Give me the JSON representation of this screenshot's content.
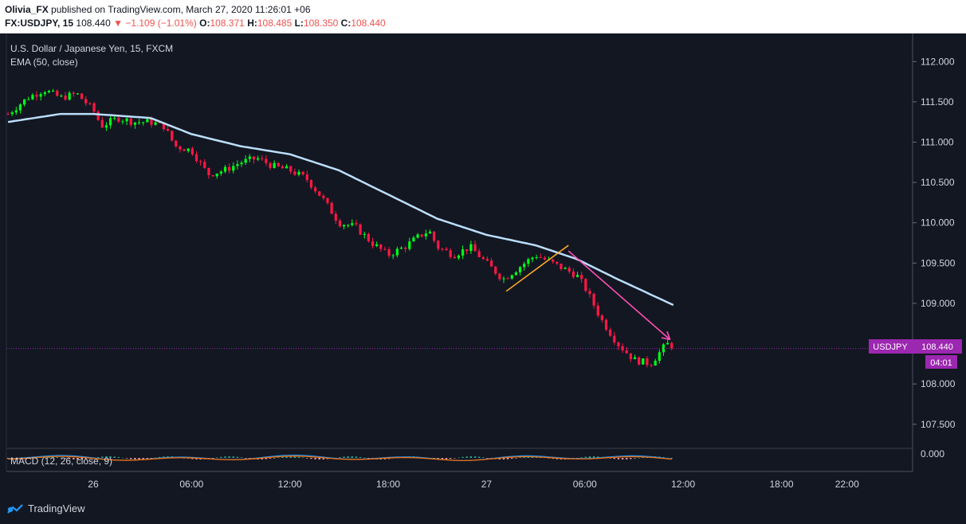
{
  "header": {
    "author": "Olivia_FX",
    "published": "published on TradingView.com, March 27, 2020 11:26:01 +06",
    "symbol": "FX:USDJPY, 15",
    "last": "108.440",
    "change": "−1.109 (−1.01%)",
    "o_label": "O:",
    "o_value": "108.371",
    "h_label": "H:",
    "h_value": "108.485",
    "l_label": "L:",
    "l_value": "108.350",
    "c_label": "C:",
    "c_value": "108.440"
  },
  "pane": {
    "title": "U.S. Dollar / Japanese Yen, 15, FXCM",
    "indicator": "EMA (50, close)",
    "macd": "MACD (12, 26, close, 9)",
    "price_label_symbol": "USDJPY",
    "price_label_value": "108.440",
    "countdown": "04:01",
    "macd_zero": "0.000"
  },
  "brand": {
    "name": "TradingView"
  },
  "colors": {
    "background": "#131722",
    "up": "#00ff1a",
    "down": "#ff1744",
    "ema": "#bbdefb",
    "badge": "#9c27b0",
    "trend_yellow": "#f9a825",
    "trend_pink": "#ff4fb4"
  },
  "chart_data": {
    "type": "candlestick",
    "title": "U.S. Dollar / Japanese Yen, 15, FXCM",
    "y_ticks": [
      "112.000",
      "111.500",
      "111.000",
      "110.500",
      "110.000",
      "109.500",
      "109.000",
      "108.500",
      "108.000",
      "107.500"
    ],
    "ylim": [
      107.3,
      112.25
    ],
    "x_ticks": [
      "26",
      "06:00",
      "12:00",
      "18:00",
      "27",
      "06:00",
      "12:00",
      "18:00",
      "22:00"
    ],
    "x_tick_hours": [
      0,
      6,
      12,
      18,
      24,
      30,
      36,
      42,
      46
    ],
    "xlim_hours": [
      -5.3,
      50
    ],
    "close_anchors": [
      [
        -5.2,
        111.35
      ],
      [
        -4.0,
        111.55
      ],
      [
        -3.0,
        111.65
      ],
      [
        -2.0,
        111.55
      ],
      [
        -1.0,
        111.6
      ],
      [
        0.0,
        111.4
      ],
      [
        0.5,
        111.2
      ],
      [
        1.5,
        111.3
      ],
      [
        2.5,
        111.25
      ],
      [
        3.5,
        111.25
      ],
      [
        4.3,
        111.2
      ],
      [
        5.0,
        110.95
      ],
      [
        6.0,
        110.9
      ],
      [
        7.0,
        110.6
      ],
      [
        8.0,
        110.65
      ],
      [
        9.0,
        110.75
      ],
      [
        10.0,
        110.8
      ],
      [
        11.0,
        110.7
      ],
      [
        12.0,
        110.65
      ],
      [
        13.0,
        110.55
      ],
      [
        14.0,
        110.3
      ],
      [
        15.0,
        110.0
      ],
      [
        16.0,
        109.95
      ],
      [
        17.0,
        109.75
      ],
      [
        18.0,
        109.6
      ],
      [
        19.0,
        109.7
      ],
      [
        20.0,
        109.85
      ],
      [
        20.5,
        109.9
      ],
      [
        21.0,
        109.7
      ],
      [
        22.0,
        109.6
      ],
      [
        23.0,
        109.7
      ],
      [
        24.0,
        109.5
      ],
      [
        25.0,
        109.3
      ],
      [
        26.0,
        109.45
      ],
      [
        27.0,
        109.6
      ],
      [
        27.5,
        109.55
      ],
      [
        28.5,
        109.45
      ],
      [
        29.5,
        109.35
      ],
      [
        30.0,
        109.2
      ],
      [
        31.0,
        108.8
      ],
      [
        32.0,
        108.5
      ],
      [
        33.0,
        108.3
      ],
      [
        34.0,
        108.25
      ],
      [
        35.0,
        108.5
      ],
      [
        35.5,
        108.44
      ]
    ],
    "ema_anchors": [
      [
        -5.2,
        111.25
      ],
      [
        -2.0,
        111.35
      ],
      [
        0.0,
        111.35
      ],
      [
        3.5,
        111.3
      ],
      [
        6.0,
        111.1
      ],
      [
        9.0,
        110.95
      ],
      [
        12.0,
        110.85
      ],
      [
        15.0,
        110.65
      ],
      [
        18.0,
        110.35
      ],
      [
        21.0,
        110.05
      ],
      [
        24.0,
        109.85
      ],
      [
        27.0,
        109.72
      ],
      [
        29.5,
        109.55
      ],
      [
        32.0,
        109.3
      ],
      [
        35.5,
        108.97
      ]
    ],
    "last_close": 108.44,
    "ema_last": 108.97,
    "trendlines": [
      {
        "color": "yellow",
        "from": [
          25.2,
          109.15
        ],
        "to": [
          29.0,
          109.72
        ]
      },
      {
        "color": "pink",
        "from": [
          29.0,
          109.65
        ],
        "to": [
          35.2,
          108.55
        ]
      }
    ]
  }
}
